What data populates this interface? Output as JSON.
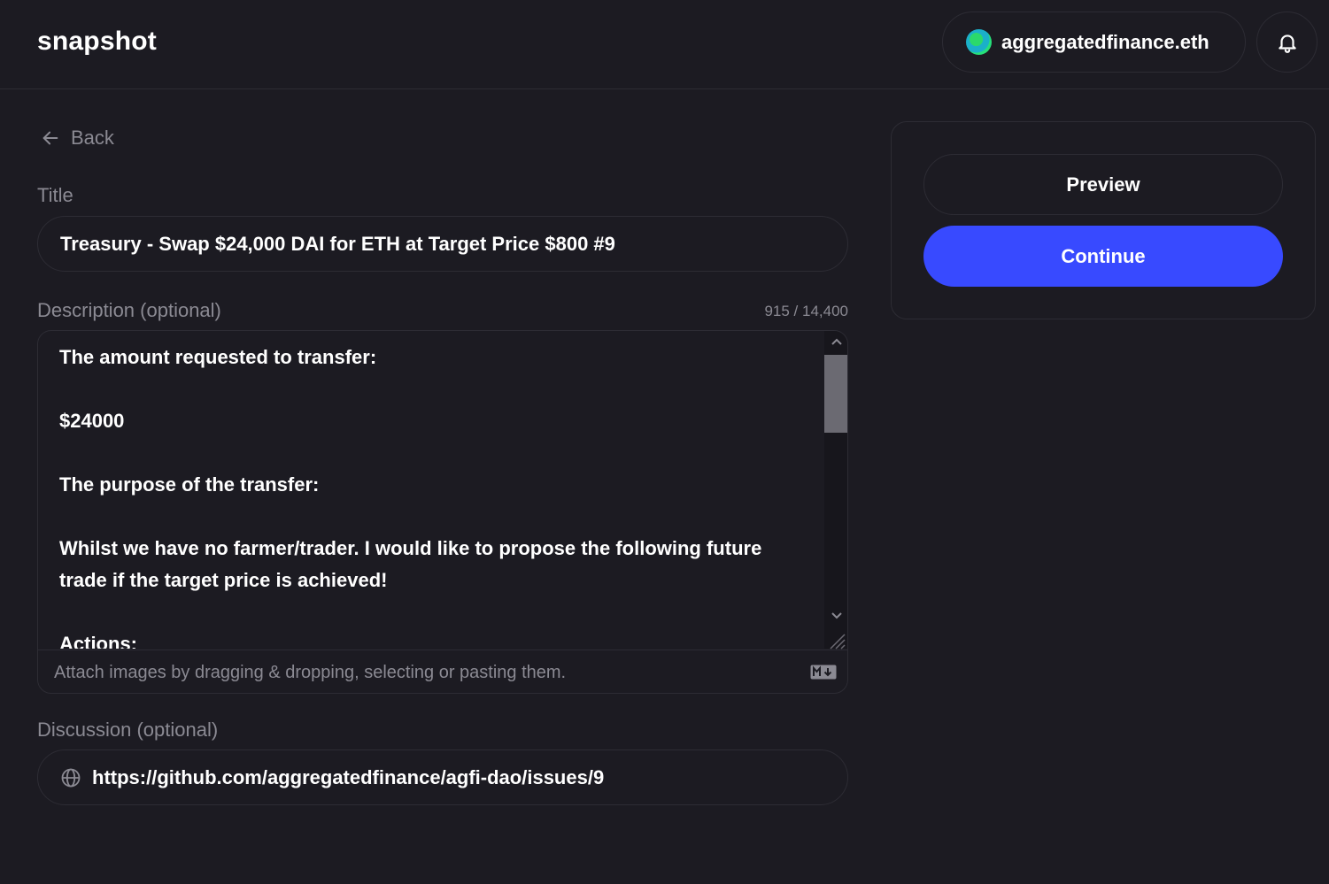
{
  "header": {
    "logo": "snapshot",
    "account_name": "aggregatedfinance.eth"
  },
  "back_label": "Back",
  "title_field": {
    "label": "Title",
    "value": "Treasury - Swap $24,000 DAI for ETH at Target Price $800 #9"
  },
  "description_field": {
    "label": "Description (optional)",
    "counter": "915 / 14,400",
    "lines": [
      "The amount requested to transfer:",
      "$24000",
      "The purpose of the transfer:",
      "Whilst we have no farmer/trader. I would like to propose the following future trade if the target price is achieved!",
      "Actions:"
    ],
    "footer_hint": "Attach images by dragging & dropping, selecting or pasting them.",
    "markdown_badge": "M↓"
  },
  "discussion_field": {
    "label": "Discussion (optional)",
    "value": "https://github.com/aggregatedfinance/agfi-dao/issues/9"
  },
  "actions": {
    "preview_label": "Preview",
    "continue_label": "Continue"
  },
  "colors": {
    "background": "#1c1b22",
    "border": "#2d2c34",
    "muted_text": "#8b8a93",
    "primary": "#384aff"
  },
  "icons": [
    "bell-icon",
    "arrow-left-icon",
    "globe-icon",
    "markdown-icon",
    "chevron-up-icon",
    "chevron-down-icon",
    "resize-icon"
  ]
}
